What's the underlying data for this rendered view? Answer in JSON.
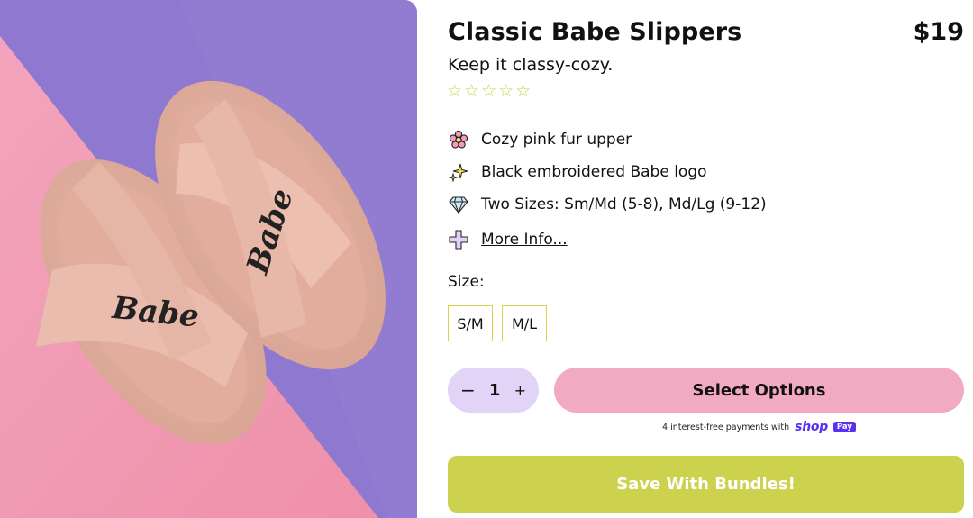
{
  "product": {
    "title": "Classic Babe Slippers",
    "price": "$19",
    "subtitle": "Keep it classy-cozy.",
    "stars": "☆☆☆☆☆",
    "rating": 0,
    "image_text_left": "Babe",
    "image_text_right": "Babe"
  },
  "features": [
    {
      "icon": "flower-icon",
      "label": "Cozy pink fur upper"
    },
    {
      "icon": "sparkles-icon",
      "label": "Black embroidered Babe logo"
    },
    {
      "icon": "diamond-icon",
      "label": "Two Sizes: Sm/Md (5-8), Md/Lg (9-12)"
    },
    {
      "icon": "plus-icon",
      "label": "More Info..."
    }
  ],
  "size": {
    "label": "Size:",
    "options": [
      "S/M",
      "M/L"
    ]
  },
  "quantity": {
    "minus": "−",
    "value": "1",
    "plus": "+"
  },
  "actions": {
    "select_options": "Select Options",
    "save_bundles": "Save With Bundles!"
  },
  "shoppay": {
    "text": "4 interest-free payments with",
    "logo": "shop",
    "badge": "Pay"
  },
  "colors": {
    "accent_pink": "#f2a9c2",
    "accent_lime": "#cdd24e",
    "qty_bg": "#e1d4f7",
    "shoppay_purple": "#5a31f4",
    "size_border": "#d8d14a"
  }
}
